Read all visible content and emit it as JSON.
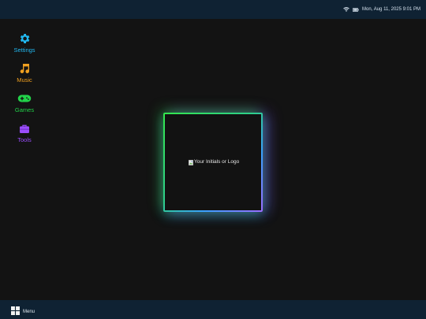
{
  "status_bar": {
    "datetime": "Mon, Aug 11, 2025 9:01 PM",
    "icons": [
      "wifi-icon",
      "battery-icon"
    ]
  },
  "desktop_icons": [
    {
      "label": "Settings",
      "icon": "gear-icon",
      "color": "#22b8f0"
    },
    {
      "label": "Music",
      "icon": "music-note-icon",
      "color": "#f0a020"
    },
    {
      "label": "Games",
      "icon": "gamepad-icon",
      "color": "#22d34a"
    },
    {
      "label": "Tools",
      "icon": "toolbox-icon",
      "color": "#9b4dff"
    }
  ],
  "logo": {
    "alt_text": "Your Initials or Logo"
  },
  "taskbar": {
    "menu_label": "Menu",
    "menu_icon": "windows-grid-icon"
  },
  "colors": {
    "bar_background": "#0f2233",
    "desktop_background": "#131313"
  }
}
